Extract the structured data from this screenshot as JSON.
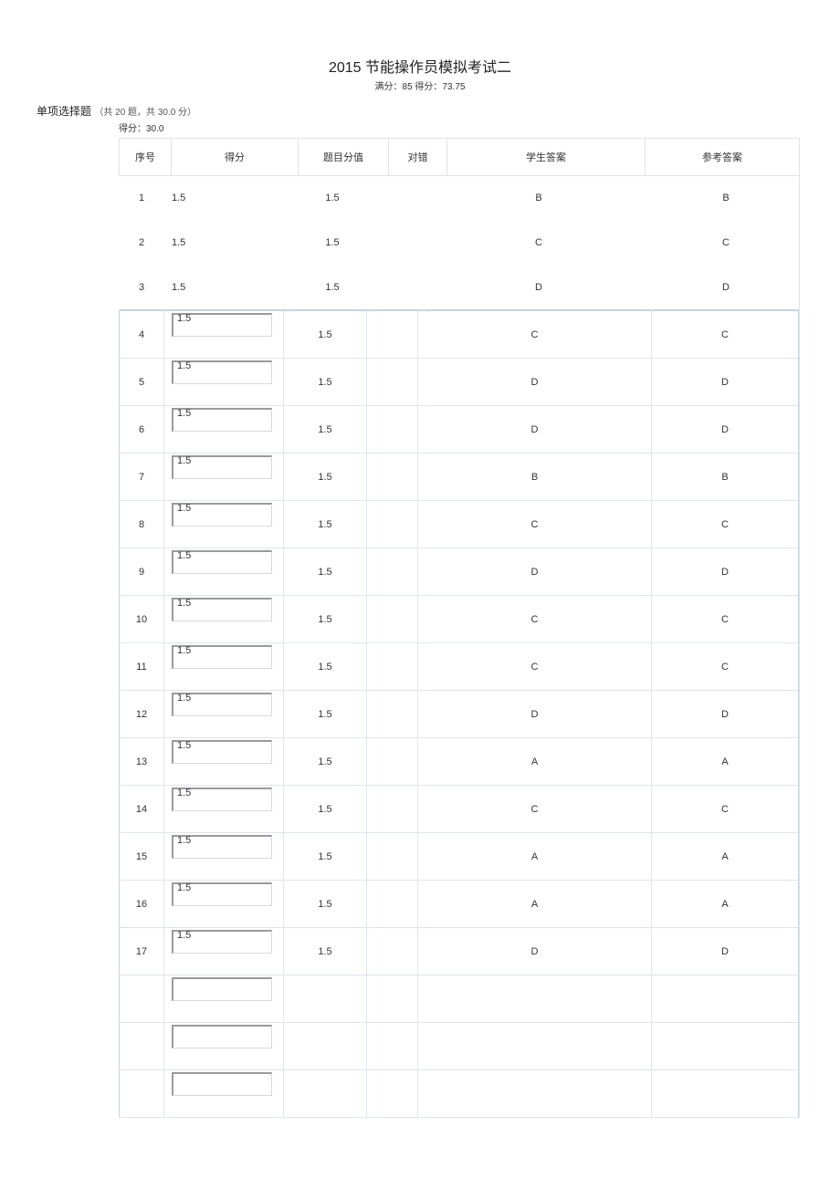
{
  "title": "2015 节能操作员模拟考试二",
  "subtitle_full": "满分：85 得分：73.75",
  "section_title": "单项选择题",
  "section_meta": "（共 20 题，共 30.0 分）",
  "score_line": "得分：30.0",
  "headers": {
    "index": "序号",
    "score": "得分",
    "value": "题目分值",
    "correct": "对错",
    "student": "学生答案",
    "reference": "参考答案"
  },
  "rows": [
    {
      "idx": "1",
      "score": "1.5",
      "value": "1.5",
      "correct": "",
      "student": "B",
      "reference": "B",
      "styled": false
    },
    {
      "idx": "2",
      "score": "1.5",
      "value": "1.5",
      "correct": "",
      "student": "C",
      "reference": "C",
      "styled": false
    },
    {
      "idx": "3",
      "score": "1.5",
      "value": "1.5",
      "correct": "",
      "student": "D",
      "reference": "D",
      "styled": false
    },
    {
      "idx": "4",
      "score": "1.5",
      "value": "1.5",
      "correct": "",
      "student": "C",
      "reference": "C",
      "styled": true
    },
    {
      "idx": "5",
      "score": "1.5",
      "value": "1.5",
      "correct": "",
      "student": "D",
      "reference": "D",
      "styled": true
    },
    {
      "idx": "6",
      "score": "1.5",
      "value": "1.5",
      "correct": "",
      "student": "D",
      "reference": "D",
      "styled": true
    },
    {
      "idx": "7",
      "score": "1.5",
      "value": "1.5",
      "correct": "",
      "student": "B",
      "reference": "B",
      "styled": true
    },
    {
      "idx": "8",
      "score": "1.5",
      "value": "1.5",
      "correct": "",
      "student": "C",
      "reference": "C",
      "styled": true
    },
    {
      "idx": "9",
      "score": "1.5",
      "value": "1.5",
      "correct": "",
      "student": "D",
      "reference": "D",
      "styled": true
    },
    {
      "idx": "10",
      "score": "1.5",
      "value": "1.5",
      "correct": "",
      "student": "C",
      "reference": "C",
      "styled": true
    },
    {
      "idx": "11",
      "score": "1.5",
      "value": "1.5",
      "correct": "",
      "student": "C",
      "reference": "C",
      "styled": true
    },
    {
      "idx": "12",
      "score": "1.5",
      "value": "1.5",
      "correct": "",
      "student": "D",
      "reference": "D",
      "styled": true
    },
    {
      "idx": "13",
      "score": "1.5",
      "value": "1.5",
      "correct": "",
      "student": "A",
      "reference": "A",
      "styled": true
    },
    {
      "idx": "14",
      "score": "1.5",
      "value": "1.5",
      "correct": "",
      "student": "C",
      "reference": "C",
      "styled": true
    },
    {
      "idx": "15",
      "score": "1.5",
      "value": "1.5",
      "correct": "",
      "student": "A",
      "reference": "A",
      "styled": true
    },
    {
      "idx": "16",
      "score": "1.5",
      "value": "1.5",
      "correct": "",
      "student": "A",
      "reference": "A",
      "styled": true
    },
    {
      "idx": "17",
      "score": "1.5",
      "value": "1.5",
      "correct": "",
      "student": "D",
      "reference": "D",
      "styled": true
    },
    {
      "idx": "",
      "score": "",
      "value": "",
      "correct": "",
      "student": "",
      "reference": "",
      "styled": true
    },
    {
      "idx": "",
      "score": "",
      "value": "",
      "correct": "",
      "student": "",
      "reference": "",
      "styled": true
    },
    {
      "idx": "",
      "score": "",
      "value": "",
      "correct": "",
      "student": "",
      "reference": "",
      "styled": true
    }
  ]
}
